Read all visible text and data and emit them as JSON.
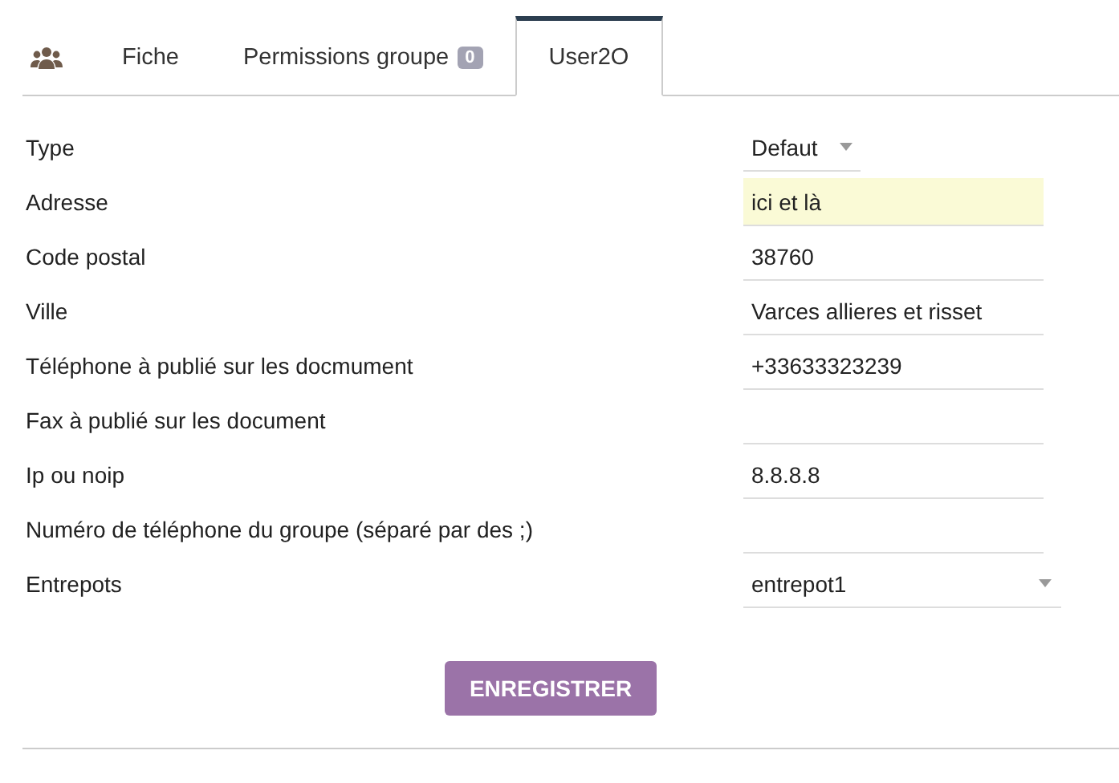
{
  "tabs": [
    {
      "kind": "icon",
      "selected": false
    },
    {
      "kind": "text",
      "label": "Fiche",
      "selected": false
    },
    {
      "kind": "text",
      "label": "Permissions groupe",
      "badge": "0",
      "selected": false
    },
    {
      "kind": "text",
      "label": "User2O",
      "selected": true
    }
  ],
  "fields": [
    {
      "label": "Type",
      "kind": "compact-select",
      "value": "Defaut"
    },
    {
      "label": "Adresse",
      "kind": "text",
      "value": "ici et là",
      "highlighted": true
    },
    {
      "label": "Code postal",
      "kind": "text",
      "value": "38760",
      "highlighted": false
    },
    {
      "label": "Ville",
      "kind": "text",
      "value": "Varces allieres et risset",
      "highlighted": false
    },
    {
      "label": "Téléphone à publié sur les docmument",
      "kind": "text",
      "value": "+33633323239",
      "highlighted": false
    },
    {
      "label": "Fax à publié sur les document",
      "kind": "text",
      "highlighted": false
    },
    {
      "label": "Ip ou noip",
      "kind": "text",
      "value": "8.8.8.8",
      "highlighted": false
    },
    {
      "label": "Numéro de téléphone du groupe (séparé par des ;)",
      "kind": "text",
      "highlighted": false
    },
    {
      "label": "Entrepots",
      "kind": "select",
      "value": "entrepot1"
    }
  ],
  "save_button": "ENREGISTRER"
}
